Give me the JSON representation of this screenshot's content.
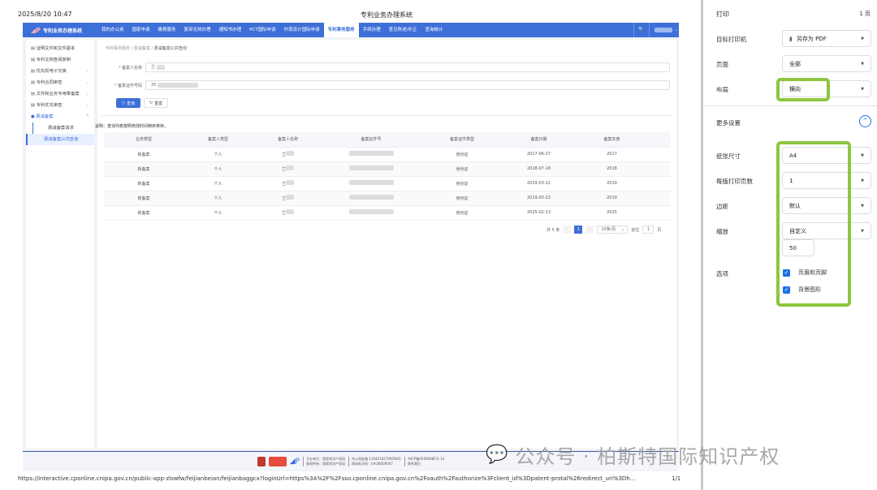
{
  "header": {
    "datetime": "2025/8/20 10:47",
    "title": "专利业务办理系统"
  },
  "nav": {
    "logo": "专利业务办理系统",
    "items": [
      "我的办公桌",
      "国家申请",
      "缴费服务",
      "复审无效办理",
      "通知书办理",
      "PCT国际申请",
      "外观设计国际申请",
      "专利事务服务",
      "手续办理",
      "意见陈述/补正",
      "查询统计"
    ],
    "active_index": 7,
    "search_icon": "search-icon"
  },
  "sidebar": {
    "items": [
      {
        "label": "证明文件和文件副本",
        "icon": "doc-icon",
        "expandable": false
      },
      {
        "label": "专利文档查阅复制",
        "icon": "doc-icon",
        "expandable": false
      },
      {
        "label": "优先权电子交换",
        "icon": "list-icon",
        "expandable": true
      },
      {
        "label": "专利合同审查",
        "icon": "list-icon",
        "expandable": true
      },
      {
        "label": "文件和业务专用章备案",
        "icon": "doc-icon",
        "expandable": true
      },
      {
        "label": "专利优先审查",
        "icon": "list-icon",
        "expandable": true
      },
      {
        "label": "费减备案",
        "icon": "gear-icon",
        "expandable": true,
        "open": true
      }
    ],
    "subitems": [
      "费减备案请求",
      "费减备案公共查询"
    ],
    "selected_sub": 1
  },
  "breadcrumb": [
    "专利事务服务",
    "费减备案",
    "费减备案公共查询"
  ],
  "form": {
    "name_label": "备案人名称",
    "name_value": "兰",
    "id_label": "备案证件号码",
    "id_value": "35",
    "query_button": "查询",
    "reset_button": "重置"
  },
  "note": "说明：查询列表按照修改时间倒序排序。",
  "table": {
    "columns": [
      "业务类型",
      "备案人类型",
      "备案人名称",
      "备案证件号",
      "备案证件类型",
      "备案日期",
      "备案年度"
    ],
    "rows": [
      [
        "新备案",
        "个人",
        "兰",
        "",
        "身份证",
        "2017-06-27",
        "2017"
      ],
      [
        "新备案",
        "个人",
        "兰",
        "",
        "身份证",
        "2018-07-18",
        "2018"
      ],
      [
        "新备案",
        "个人",
        "兰",
        "",
        "身份证",
        "2019-03-12",
        "2019"
      ],
      [
        "新备案",
        "个人",
        "兰",
        "",
        "身份证",
        "2019-03-23",
        "2019"
      ],
      [
        "新备案",
        "个人",
        "兰",
        "",
        "身份证",
        "2025-02-13",
        "2025"
      ]
    ]
  },
  "pagination": {
    "total": "共 5 条",
    "current": "1",
    "page_size": "10条/页",
    "goto_label": "前往",
    "goto_value": "1",
    "page_unit": "页"
  },
  "footer": {
    "sponsor": "主办单位：国家知识产权局",
    "copyright": "版权所有：国家知识产权局",
    "police": "京公网安备 11040102700058号",
    "site_code": "网站标识码：bm38000007",
    "icp": "京ICP备05069085号-14",
    "contact": "联系我们"
  },
  "status": {
    "url": "https://interactive.cponline.cnipa.gov.cn/public-app-zlswfw/feijianbeian/feijianbaggcx?loginUrl=https%3A%2F%2Fsso.cponline.cnipa.gov.cn%2Foauth%2Fauthorize%3Fclient_id%3Dpatent-protal%26redirect_uri%3Dh...",
    "page": "1/1"
  },
  "print": {
    "title": "打印",
    "pages": "1 页",
    "destination_label": "目标打印机",
    "destination": "另存为 PDF",
    "pages_label": "页面",
    "pages_value": "全部",
    "layout_label": "布局",
    "layout_value": "横向",
    "more_settings": "更多设置",
    "paper_label": "纸张尺寸",
    "paper_value": "A4",
    "per_sheet_label": "每版打印页数",
    "per_sheet_value": "1",
    "margins_label": "边距",
    "margins_value": "默认",
    "scale_label": "缩放",
    "scale_value": "自定义",
    "scale_number": "50",
    "options_label": "选项",
    "opt_headers": "页眉和页脚",
    "opt_headers_checked": true,
    "opt_bg": "背景图形",
    "opt_bg_checked": true,
    "highlight_color": "#8cc63f"
  },
  "watermark": "公众号 · 柏斯特国际知识产权",
  "colors": {
    "primary": "#3d6fd8",
    "highlight": "#8cc63f"
  }
}
